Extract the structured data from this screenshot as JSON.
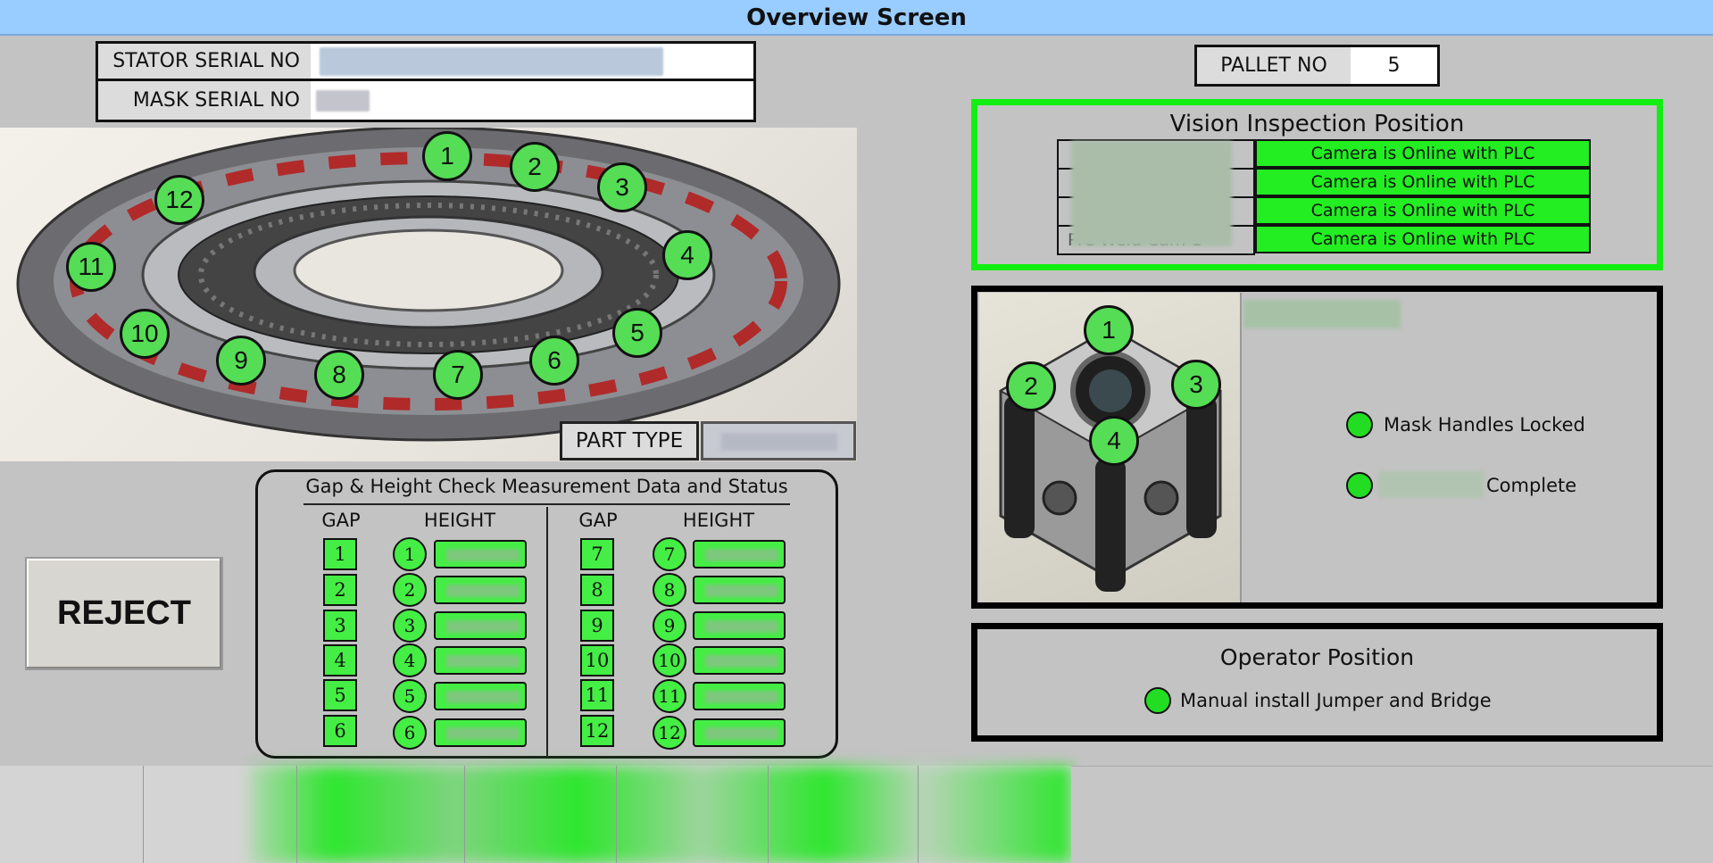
{
  "header": {
    "title": "Overview Screen"
  },
  "fields": {
    "stator_serial_label": "STATOR SERIAL NO",
    "mask_serial_label": "MASK SERIAL NO",
    "pallet_label": "PALLET NO",
    "pallet_value": "5",
    "part_type_label": "PART TYPE"
  },
  "stator_positions": [
    "1",
    "2",
    "3",
    "4",
    "5",
    "6",
    "7",
    "8",
    "9",
    "10",
    "11",
    "12"
  ],
  "measurement": {
    "title": "Gap & Height Check Measurement Data and Status",
    "gap_header": "GAP",
    "height_header": "HEIGHT",
    "left_rows": [
      "1",
      "2",
      "3",
      "4",
      "5",
      "6"
    ],
    "right_rows": [
      "7",
      "8",
      "9",
      "10",
      "11",
      "12"
    ]
  },
  "reject_label": "REJECT",
  "vision": {
    "title": "Vision Inspection Position",
    "camera_status": [
      "Camera is Online with PLC",
      "Camera is Online with PLC",
      "Camera is Online with PLC",
      "Camera is Online with PLC"
    ],
    "partial_name": "Pre Weld Cam 1"
  },
  "mask": {
    "positions": [
      "1",
      "2",
      "3",
      "4"
    ],
    "status_1": "Mask Handles Locked",
    "status_2": "Complete"
  },
  "operator": {
    "title": "Operator Position",
    "status": "Manual install Jumper and Bridge"
  },
  "colors": {
    "accent_green": "#22ee22",
    "title_bar": "#99ccff",
    "background": "#c3c3c3"
  }
}
